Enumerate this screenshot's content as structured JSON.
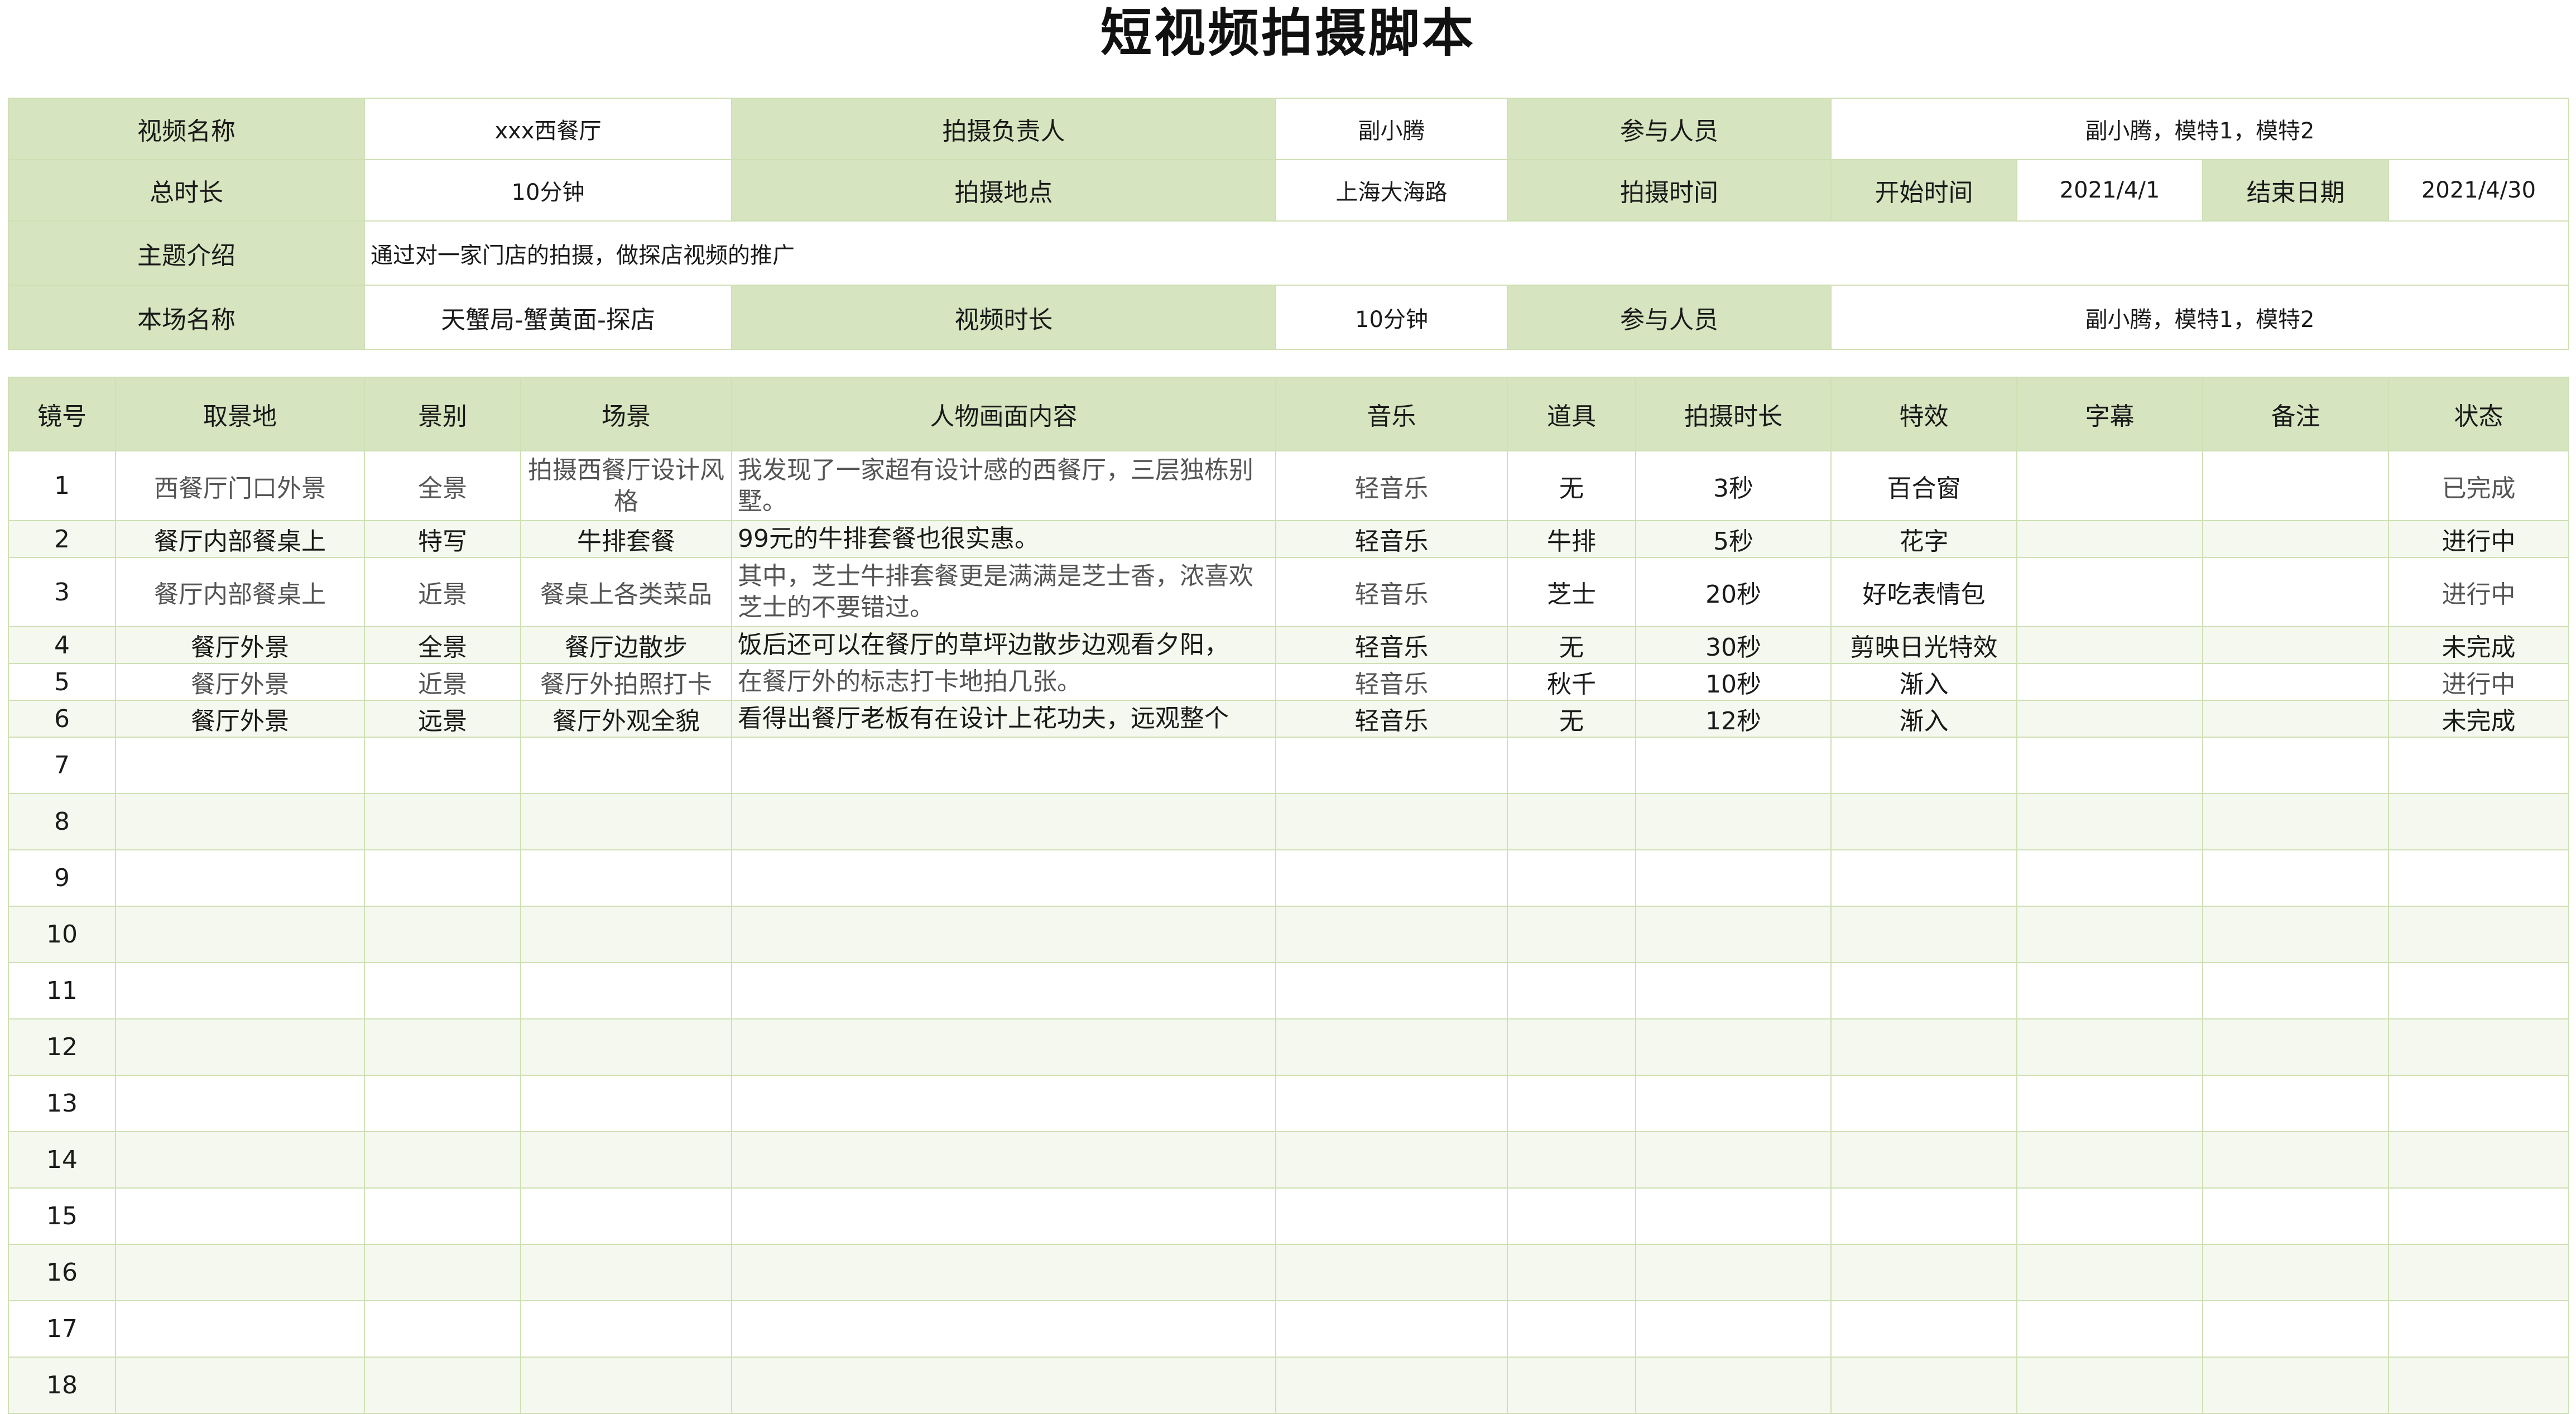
{
  "title": "短视频拍摄脚本",
  "info": {
    "video_name_label": "视频名称",
    "video_name": "xxx西餐厅",
    "owner_label": "拍摄负责人",
    "owner": "副小腾",
    "participants_label": "参与人员",
    "participants": "副小腾，模特1，模特2",
    "duration_label": "总时长",
    "duration": "10分钟",
    "location_label": "拍摄地点",
    "location": "上海大海路",
    "time_label": "拍摄时间",
    "start_label": "开始时间",
    "start": "2021/4/1",
    "end_label": "结束日期",
    "end": "2021/4/30",
    "topic_label": "主题介绍",
    "topic": "通过对一家门店的拍摄，做探店视频的推广",
    "scene_name_label": "本场名称",
    "scene_name": "天蟹局-蟹黄面-探店",
    "video_len_label": "视频时长",
    "video_len": "10分钟",
    "participants2_label": "参与人员",
    "participants2": "副小腾，模特1，模特2"
  },
  "shots": {
    "headers": [
      "镜号",
      "取景地",
      "景别",
      "场景",
      "人物画面内容",
      "音乐",
      "道具",
      "拍摄时长",
      "特效",
      "字幕",
      "备注",
      "状态"
    ],
    "rows": [
      [
        "1",
        "西餐厅门口外景",
        "全景",
        "拍摄西餐厅设计风格",
        "我发现了一家超有设计感的西餐厅，三层独栋别墅。",
        "轻音乐",
        "无",
        "3秒",
        "百合窗",
        "",
        "",
        "已完成"
      ],
      [
        "2",
        "餐厅内部餐桌上",
        "特写",
        "牛排套餐",
        "99元的牛排套餐也很实惠。",
        "轻音乐",
        "牛排",
        "5秒",
        "花字",
        "",
        "",
        "进行中"
      ],
      [
        "3",
        "餐厅内部餐桌上",
        "近景",
        "餐桌上各类菜品",
        "其中，芝士牛排套餐更是满满是芝士香，浓喜欢芝士的不要错过。",
        "轻音乐",
        "芝士",
        "20秒",
        "好吃表情包",
        "",
        "",
        "进行中"
      ],
      [
        "4",
        "餐厅外景",
        "全景",
        "餐厅边散步",
        "饭后还可以在餐厅的草坪边散步边观看夕阳，",
        "轻音乐",
        "无",
        "30秒",
        "剪映日光特效",
        "",
        "",
        "未完成"
      ],
      [
        "5",
        "餐厅外景",
        "近景",
        "餐厅外拍照打卡",
        "在餐厅外的标志打卡地拍几张。",
        "轻音乐",
        "秋千",
        "10秒",
        "渐入",
        "",
        "",
        "进行中"
      ],
      [
        "6",
        "餐厅外景",
        "远景",
        "餐厅外观全貌",
        "看得出餐厅老板有在设计上花功夫，远观整个",
        "轻音乐",
        "无",
        "12秒",
        "渐入",
        "",
        "",
        "未完成"
      ]
    ],
    "empty_numbers": [
      "7",
      "8",
      "9",
      "10",
      "11",
      "12",
      "13",
      "14",
      "15",
      "16",
      "17",
      "18"
    ]
  },
  "colors": {
    "header_fill": "#d6e4bf",
    "grid": "#cfe0b4",
    "alt_row": "#f5f8ee"
  }
}
